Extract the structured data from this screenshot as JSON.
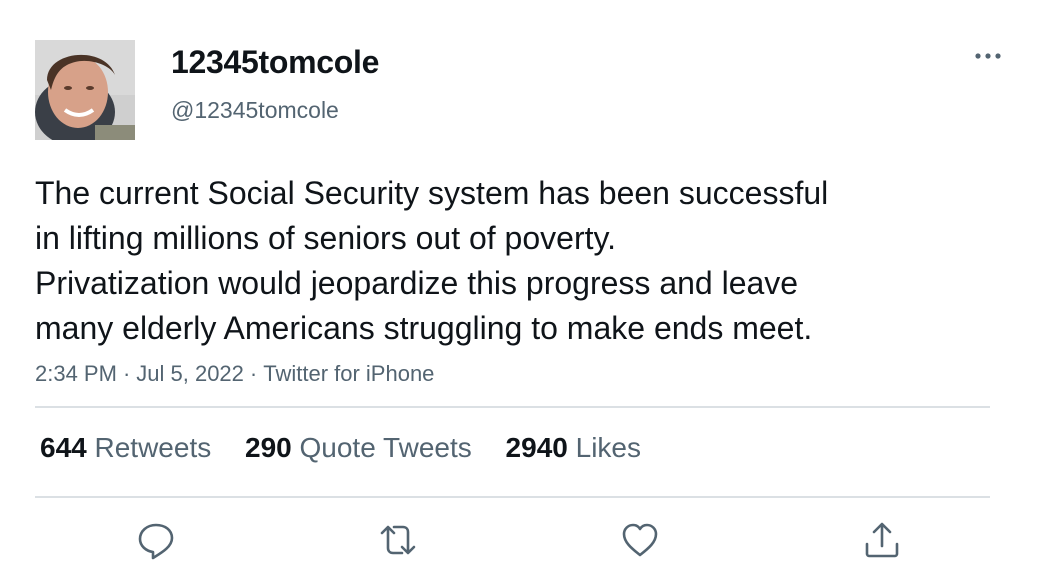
{
  "user": {
    "display_name": "12345tomcole",
    "handle": "@12345tomcole",
    "avatar_icon": "profile-photo"
  },
  "tweet": {
    "lines": [
      "The current Social Security system has been successful",
      "in lifting millions of seniors out of poverty.",
      "Privatization would jeopardize this progress and leave",
      "many elderly Americans struggling to make ends meet."
    ],
    "time": "2:34 PM",
    "separator": "·",
    "date": "Jul 5, 2022",
    "source": "Twitter for iPhone"
  },
  "stats": {
    "retweets_count": "644",
    "retweets_label": "Retweets",
    "quotes_count": "290",
    "quotes_label": "Quote Tweets",
    "likes_count": "2940",
    "likes_label": "Likes"
  },
  "actions": {
    "reply_icon": "reply-icon",
    "retweet_icon": "retweet-icon",
    "like_icon": "heart-icon",
    "share_icon": "share-icon",
    "more_icon": "more-icon"
  },
  "colors": {
    "text_primary": "#0f1419",
    "text_secondary": "#536471",
    "divider": "#dbe0e4",
    "icon": "#536471"
  }
}
